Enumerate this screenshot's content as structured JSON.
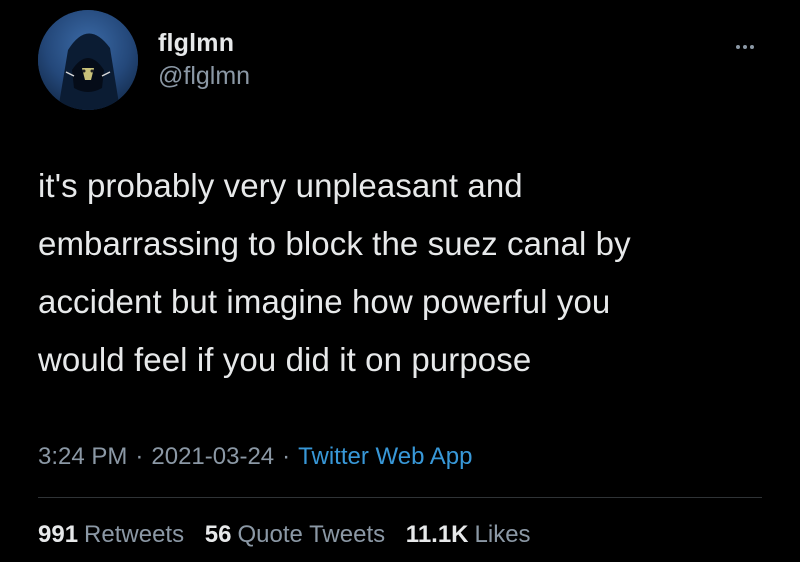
{
  "author": {
    "display_name": "flglmn",
    "handle": "@flglmn"
  },
  "tweet": {
    "text_lines": [
      "it's probably very unpleasant and",
      "embarrassing to block the suez canal by",
      "accident but imagine how powerful you",
      "would feel if you did it on purpose"
    ]
  },
  "meta": {
    "time": "3:24 PM",
    "separator": "·",
    "date": "2021-03-24",
    "source": "Twitter Web App"
  },
  "stats": {
    "retweets": {
      "count": "991",
      "label": "Retweets"
    },
    "quote_tweets": {
      "count": "56",
      "label": "Quote Tweets"
    },
    "likes": {
      "count": "11.1K",
      "label": "Likes"
    }
  },
  "icons": {
    "more": "more-horizontal-icon",
    "avatar": "hooded-figure-avatar"
  },
  "colors": {
    "background": "#000000",
    "text": "#e7e9ea",
    "secondary": "#8b98a5",
    "link": "#3898d8",
    "divider": "#2f3336"
  }
}
